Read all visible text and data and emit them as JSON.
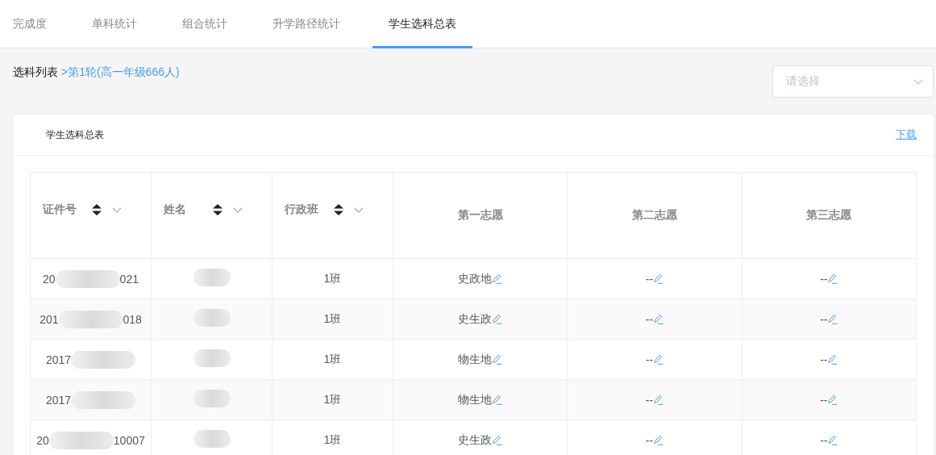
{
  "tabs": [
    {
      "label": "完成度",
      "selected": false
    },
    {
      "label": "单科统计",
      "selected": false
    },
    {
      "label": "组合统计",
      "selected": false
    },
    {
      "label": "升学路径统计",
      "selected": false
    },
    {
      "label": "学生选科总表",
      "selected": true
    }
  ],
  "breadcrumb": {
    "root": "选科列表",
    "current": ">第1轮(高一年级666人)"
  },
  "round_select": {
    "placeholder": "请选择"
  },
  "card": {
    "title": "学生选科总表",
    "download": "下载"
  },
  "table": {
    "columns": [
      {
        "label": "证件号",
        "sortable": true
      },
      {
        "label": "姓名",
        "sortable": true
      },
      {
        "label": "行政班",
        "sortable": true
      },
      {
        "label": "第一志愿",
        "sortable": false
      },
      {
        "label": "第二志愿",
        "sortable": false
      },
      {
        "label": "第三志愿",
        "sortable": false
      }
    ],
    "rows": [
      {
        "id_start": "20",
        "id_end": "021",
        "class": "1班",
        "choice_1": "史政地",
        "choice_2": "--",
        "choice_3": "--"
      },
      {
        "id_start": "201",
        "id_end": "018",
        "class": "1班",
        "choice_1": "史生政",
        "choice_2": "--",
        "choice_3": "--"
      },
      {
        "id_start": "2017",
        "class": "1班",
        "choice_1": "物生地",
        "choice_2": "--",
        "choice_3": "--"
      },
      {
        "id_start": "2017",
        "class": "1班",
        "choice_1": "物生地",
        "choice_2": "--",
        "choice_3": "--"
      },
      {
        "id_start": "20",
        "id_end": "10007",
        "class": "1班",
        "choice_1": "史生政",
        "choice_2": "--",
        "choice_3": "--"
      }
    ]
  }
}
